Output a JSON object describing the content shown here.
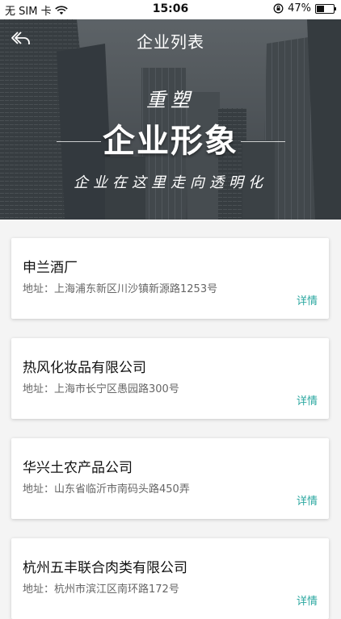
{
  "status_bar": {
    "carrier": "无 SIM 卡",
    "time": "15:06",
    "battery_percent": "47%",
    "battery_level": 0.47,
    "icons": [
      "wifi-icon",
      "rotation-lock-icon",
      "battery-icon"
    ]
  },
  "header": {
    "title": "企业列表",
    "back_icon": "back-arrow-icon"
  },
  "banner": {
    "line1": "重塑",
    "line2": "企业形象",
    "slogan": "企业在这里走向透明化"
  },
  "colors": {
    "accent": "#2aa7a0",
    "background": "#f4f4f4",
    "card": "#ffffff"
  },
  "companies": [
    {
      "name": "申兰酒厂",
      "address": "地址：上海浦东新区川沙镇新源路1253号",
      "detail_label": "详情"
    },
    {
      "name": "热风化妆品有限公司",
      "address": "地址：上海市长宁区愚园路300号",
      "detail_label": "详情"
    },
    {
      "name": "华兴土农产品公司",
      "address": "地址：山东省临沂市南码头路450弄",
      "detail_label": "详情"
    },
    {
      "name": "杭州五丰联合肉类有限公司",
      "address": "地址：杭州市滨江区南环路172号",
      "detail_label": "详情"
    }
  ]
}
